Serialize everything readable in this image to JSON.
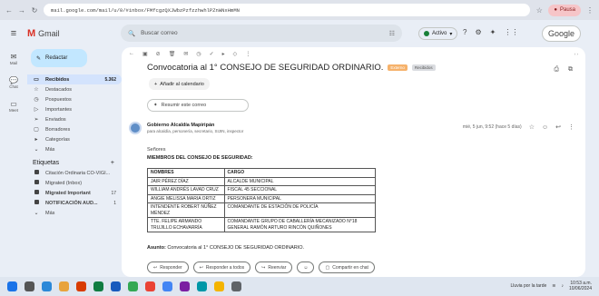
{
  "browser": {
    "url": "mail.google.com/mail/u/0/#inbox/FMfcgzQXJWbzPzfzzhwhlPZnWNxHmMN",
    "profile": "Pausa"
  },
  "header": {
    "app": "Gmail",
    "search_placeholder": "Buscar correo",
    "status": "Activo",
    "brand": "Google"
  },
  "rail": [
    {
      "icon": "mail-icon",
      "label": "Mail"
    },
    {
      "icon": "chat-icon",
      "label": "Chat"
    },
    {
      "icon": "meet-icon",
      "label": "Meet"
    }
  ],
  "sidebar": {
    "compose": "Redactar",
    "items": [
      {
        "icon": "inbox-icon",
        "label": "Recibidos",
        "count": "5.362",
        "selected": true
      },
      {
        "icon": "star-icon",
        "label": "Destacados",
        "count": ""
      },
      {
        "icon": "clock-icon",
        "label": "Pospuestos",
        "count": ""
      },
      {
        "icon": "important-icon",
        "label": "Importantes",
        "count": ""
      },
      {
        "icon": "send-icon",
        "label": "Enviados",
        "count": ""
      },
      {
        "icon": "draft-icon",
        "label": "Borradores",
        "count": ""
      },
      {
        "icon": "category-icon",
        "label": "Categorías",
        "count": ""
      },
      {
        "icon": "more-icon",
        "label": "Más",
        "count": ""
      }
    ],
    "labels_title": "Etiquetas",
    "labels": [
      {
        "label": "Citación Ordinaria CO-VIGI...",
        "count": ""
      },
      {
        "label": "Migrated (Inbox)",
        "count": ""
      },
      {
        "label": "Migrated Important",
        "count": "17"
      },
      {
        "label": "NOTIFICACIÓN AUD...",
        "count": "1"
      },
      {
        "label": "Más",
        "count": ""
      }
    ]
  },
  "email": {
    "subject": "Convocatoria al 1° CONSEJO DE SEGURIDAD ORDINARIO.",
    "tags": [
      "Externo",
      "Recibidos"
    ],
    "add_calendar": "Añadir al calendario",
    "summary": "Resumir este correo",
    "sender": "Gobierno Alcaldía Mapiripán",
    "to": "para alcaldía, personería, secretario, SIJIN, inspector",
    "time": "mié, 5 jun, 9:52 (hace 5 días)",
    "greeting": "Señores",
    "heading": "MIEMBROS DEL CONSEJO DE SEGURIDAD:",
    "table": {
      "headers": [
        "NOMBRES",
        "CARGO"
      ],
      "rows": [
        [
          "JAIR PÉREZ DÍAZ",
          "ALCALDE MUNICIPAL"
        ],
        [
          "WILLIAM ANDRÉS LAVAD CRUZ",
          "FISCAL 45 SECCIONAL"
        ],
        [
          "ANGIE MELISSA MARIA ORTIZ",
          "PERSONERA MUNICIPAL"
        ],
        [
          "INTENDENTE ROBERT NÚÑEZ MÉNDEZ",
          "COMANDANTE DE ESTACIÓN DE POLICÍA"
        ],
        [
          "TTE. FELIPE ARMANDO TRUJILLO ECHAVARRÍA",
          "COMANDANTE GRUPO DE CABALLERÍA MECANIZADO N°18 GENERAL RAMÓN ARTURO RINCÓN QUIÑONES"
        ]
      ]
    },
    "asunto_label": "Asunto:",
    "asunto": "Convocatoria al 1° CONSEJO DE SEGURIDAD ORDINARIO.",
    "actions": [
      "Responder",
      "Responder a todos",
      "Reenviar",
      "Compartir en chat"
    ]
  },
  "taskbar": {
    "weather": "Lluvia por la tarde",
    "time": "10:53 a.m.",
    "date": "10/06/2024"
  }
}
